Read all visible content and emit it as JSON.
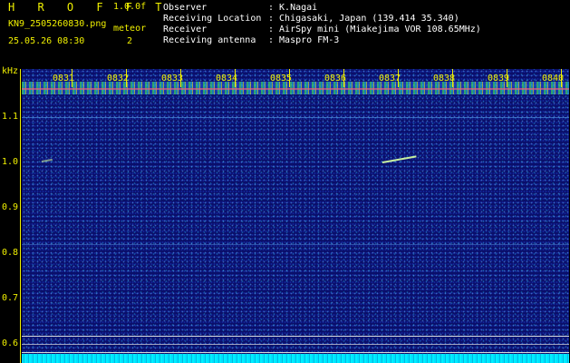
{
  "header": {
    "brand": "H R O F F T",
    "version": "1.0.0f",
    "filename": "KN9_2505260830.png",
    "meteor_label": "meteor",
    "meteor_count": "2",
    "datetime": "25.05.26 08:30",
    "observer_label": "Observer",
    "observer_value": ": K.Nagai",
    "location_label": "Receiving Location",
    "location_value": ": Chigasaki, Japan (139.414 35.340)",
    "receiver_label": "Receiver",
    "receiver_value": ": AirSpy mini (Miakejima VOR 108.65MHz)",
    "antenna_label": "Receiving antenna",
    "antenna_value": ": Maspro FM-3"
  },
  "axis": {
    "unit": "kHz",
    "time_ticks": [
      "0831",
      "0832",
      "0833",
      "0834",
      "0835",
      "0836",
      "0837",
      "0838",
      "0839",
      "0840"
    ],
    "freq_ticks": [
      "1.1",
      "1.0",
      "0.9",
      "0.8",
      "0.7",
      "0.6"
    ]
  }
}
